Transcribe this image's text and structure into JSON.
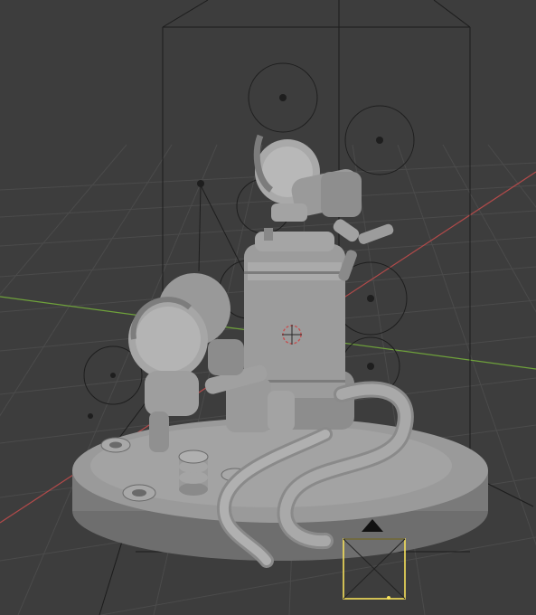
{
  "viewport": {
    "mode": "Solid shading",
    "background": "#3d3d3d",
    "grid_color": "#4a4a4a",
    "x_axis_color": "#b24a4a",
    "y_axis_color": "#6fa23b",
    "model_color": "#8e8e8e",
    "camera_active_color": "#f5e05a"
  },
  "scene_objects": [
    {
      "name": "diorama-base",
      "type": "mesh"
    },
    {
      "name": "pressure-tank",
      "type": "mesh"
    },
    {
      "name": "astronaut-left",
      "type": "mesh"
    },
    {
      "name": "astronaut-top",
      "type": "mesh"
    },
    {
      "name": "coiled-hose",
      "type": "mesh"
    },
    {
      "name": "camera",
      "type": "camera",
      "selected": true
    },
    {
      "name": "light-group",
      "type": "light",
      "count": 14
    }
  ],
  "icons": {
    "origin": "origin-icon",
    "camera": "camera-icon",
    "light": "point-light-icon"
  }
}
